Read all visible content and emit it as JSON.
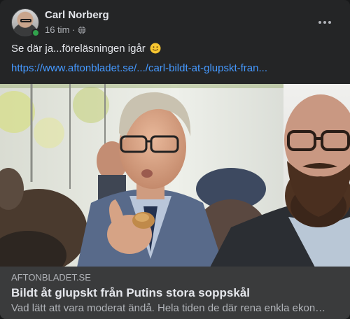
{
  "post": {
    "author": "Carl Norberg",
    "time": "16 tim ·",
    "audience_icon": "globe-icon",
    "text": "Se där ja...föreläsningen igår",
    "emoji": "slightly-smiling-face",
    "link": "https://www.aftonbladet.se/.../carl-bildt-at-glupskt-fran..."
  },
  "link_preview": {
    "domain": "AFTONBLADET.SE",
    "title": "Bildt åt glupskt från Putins stora soppskål",
    "description": "Vad lätt att vara moderat ändå. Hela tiden de där rena enkla ekon…"
  },
  "colors": {
    "card_bg": "#242526",
    "link_blue": "#4599ff",
    "online_green": "#31a24c",
    "preview_footer_bg": "#3a3b3c"
  }
}
